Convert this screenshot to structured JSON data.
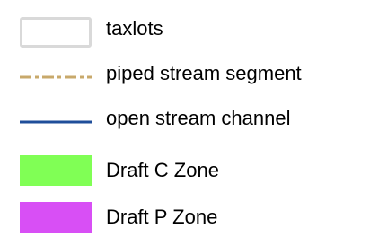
{
  "legend": {
    "items": [
      {
        "label": "taxlots",
        "symbol": "outline-box",
        "color": "#d9d9d9"
      },
      {
        "label": "piped stream segment",
        "symbol": "dash-dot-line",
        "color": "#c8a96b"
      },
      {
        "label": "open stream channel",
        "symbol": "solid-line",
        "color": "#1f4e9a"
      },
      {
        "label": "Draft C Zone",
        "symbol": "fill-box",
        "color": "#80ff55"
      },
      {
        "label": "Draft P Zone",
        "symbol": "fill-box",
        "color": "#d84ff5"
      }
    ]
  }
}
